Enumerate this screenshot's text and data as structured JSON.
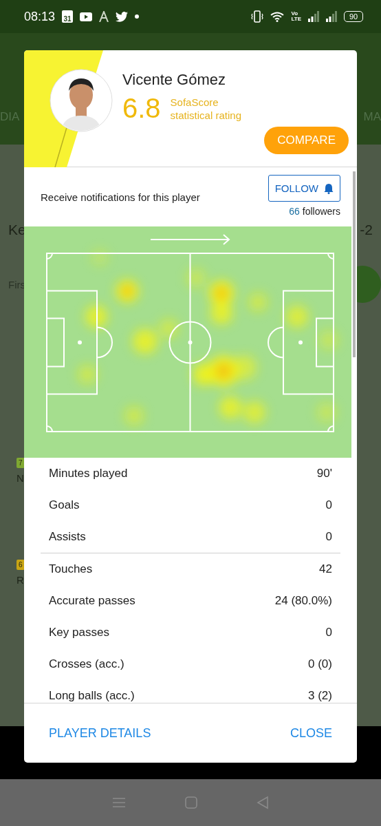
{
  "status_bar": {
    "time": "08:13",
    "calendar_day": "31",
    "network": [
      "Vo",
      "LTE"
    ],
    "battery": "90"
  },
  "background": {
    "tabs": [
      "DIA",
      "MA"
    ],
    "title": "Ke",
    "score": "-2",
    "section": "Firs",
    "players": [
      {
        "rating": "7",
        "name": "N",
        "color": "#7fa832"
      },
      {
        "rating": "6",
        "name": "R",
        "color": "#c9a514"
      }
    ]
  },
  "dialog": {
    "player_name": "Vicente Gómez",
    "rating": "6.8",
    "rating_label": "SofaScore statistical rating",
    "compare_button": "COMPARE",
    "notification_text": "Receive notifications for this player",
    "follow_button": "FOLLOW",
    "followers_count": "66",
    "followers_label": "followers",
    "stat_groups": [
      [
        {
          "label": "Minutes played",
          "value": "90'"
        },
        {
          "label": "Goals",
          "value": "0"
        },
        {
          "label": "Assists",
          "value": "0"
        }
      ],
      [
        {
          "label": "Touches",
          "value": "42"
        },
        {
          "label": "Accurate passes",
          "value": "24 (80.0%)"
        },
        {
          "label": "Key passes",
          "value": "0"
        },
        {
          "label": "Crosses (acc.)",
          "value": "0 (0)"
        },
        {
          "label": "Long balls (acc.)",
          "value": "3 (2)"
        }
      ]
    ],
    "actions": [
      "PLAYER DETAILS",
      "CLOSE"
    ]
  }
}
